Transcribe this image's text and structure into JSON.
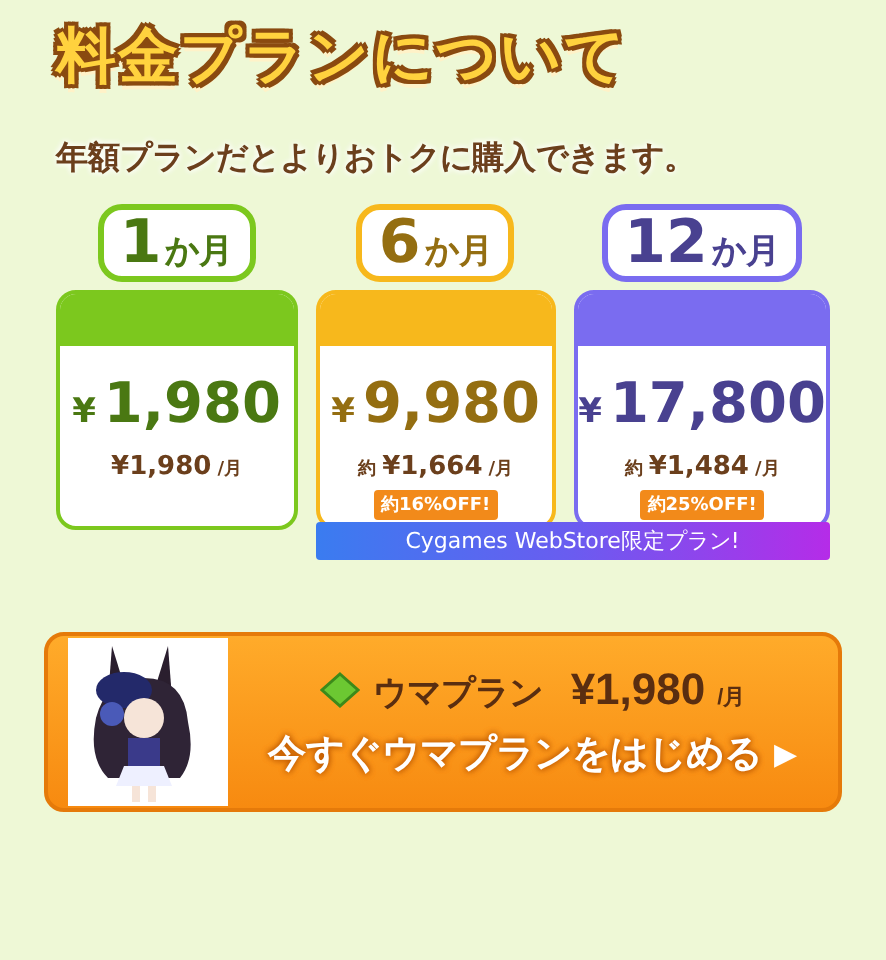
{
  "title": "料金プランについて",
  "subtitle": "年額プランだとよりおトクに購入できます。",
  "plans": [
    {
      "color": "#7cc81e",
      "number": "1",
      "unit": "か月",
      "currency": "¥",
      "amount": "1,980",
      "monthly": "¥1,980",
      "per": "/月"
    },
    {
      "color": "#f7b81c",
      "number": "6",
      "unit": "か月",
      "currency": "¥",
      "amount": "9,980",
      "approx": "約",
      "monthly": "¥1,664",
      "per": "/月",
      "discount": "約16%OFF!"
    },
    {
      "color": "#7a6cf0",
      "number": "12",
      "unit": "か月",
      "currency": "¥",
      "amount": "17,800",
      "approx": "約",
      "monthly": "¥1,484",
      "per": "/月",
      "discount": "約25%OFF!"
    }
  ],
  "store_banner": "Cygames WebStore限定プラン!",
  "cta": {
    "plan_name": "ウマプラン",
    "price": "¥1,980",
    "per": "/月",
    "label": "今すぐウマプランをはじめる",
    "arrow": "▶"
  }
}
